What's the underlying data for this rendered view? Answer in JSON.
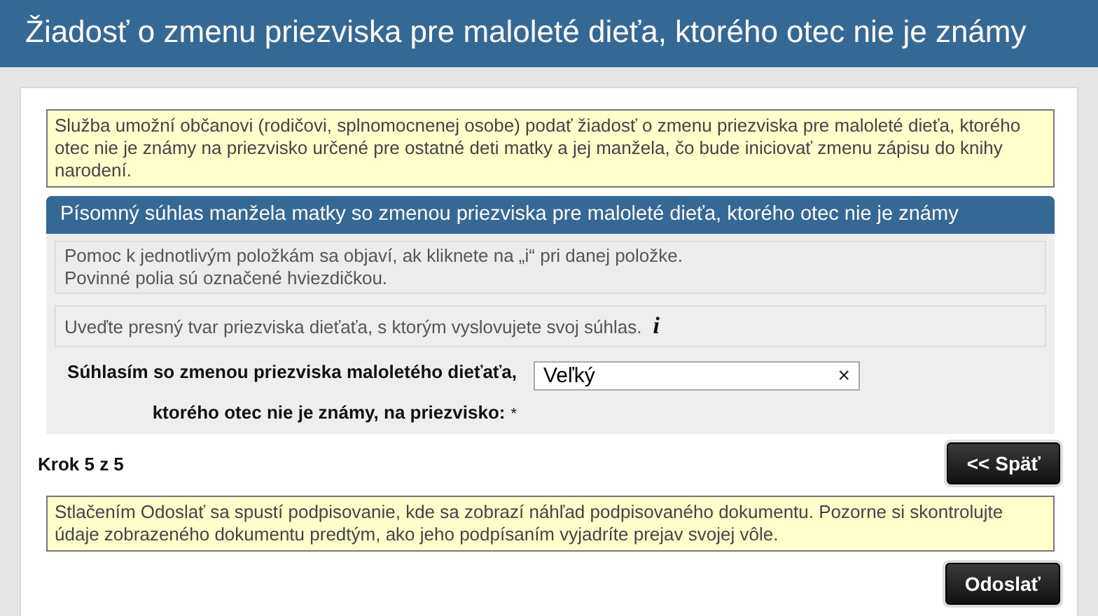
{
  "window": {
    "title": "Žiadosť o zmenu priezviska pre maloleté dieťa, ktorého otec nie je známy"
  },
  "intro_note": "Služba umožní občanovi (rodičovi, splnomocnenej osobe) podať žiadosť o zmenu priezviska pre maloleté dieťa, ktorého otec nie je známy na priezvisko určené pre ostatné deti matky a jej manžela, čo bude iniciovať zmenu zápisu do knihy narodení.",
  "section": {
    "title": "Písomný súhlas manžela matky so zmenou priezviska pre maloleté dieťa, ktorého otec nie je známy",
    "help": [
      "Pomoc k jednotlivým položkám sa objaví, ak kliknete na „i“ pri danej položke.",
      "Povinné polia sú označené hviezdičkou."
    ],
    "instruction": "Uveďte presný tvar priezviska dieťaťa, s ktorým vyslovujete svoj súhlas.",
    "info_icon": "i",
    "field": {
      "label_lines": [
        "Súhlasím so zmenou priezviska maloletého dieťaťa,",
        "ktorého otec nie je známy, na priezvisko:"
      ],
      "required_mark": "*",
      "value": "Veľký",
      "clear": "×"
    }
  },
  "step": "Krok 5 z 5",
  "back_button": "<< Späť",
  "submit_note": "Stlačením Odoslať sa spustí podpisovanie, kde sa zobrazí náhľad podpisovaného dokumentu. Pozorne si skontrolujte údaje zobrazeného dokumentu predtým, ako jeho podpísaním vyjadríte prejav svojej vôle.",
  "submit_button": "Odoslať"
}
